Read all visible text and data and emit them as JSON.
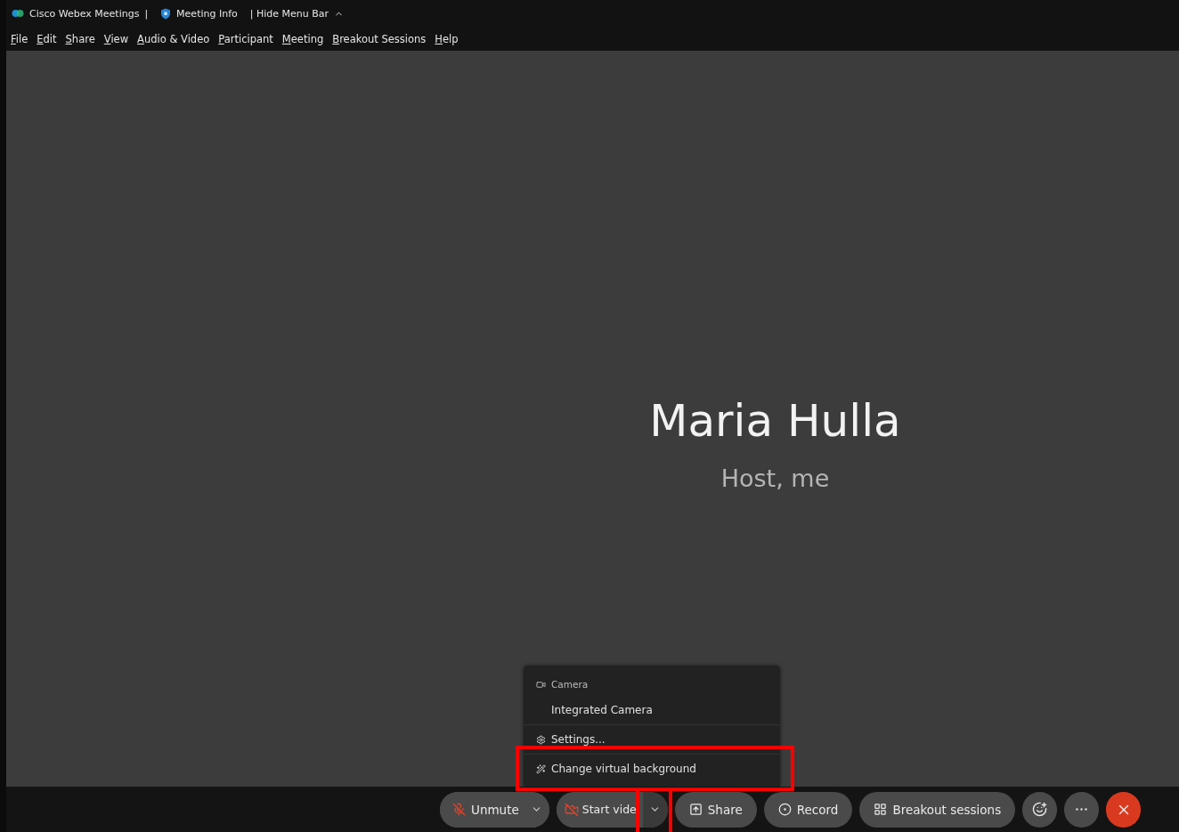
{
  "title_bar": {
    "app_name": "Cisco Webex Meetings",
    "separator": "|",
    "meeting_info": "Meeting Info",
    "hide_menu_bar": "| Hide Menu Bar"
  },
  "menu_bar": [
    "File",
    "Edit",
    "Share",
    "View",
    "Audio & Video",
    "Participant",
    "Meeting",
    "Breakout Sessions",
    "Help"
  ],
  "stage": {
    "name": "Maria Hulla",
    "role": "Host, me"
  },
  "video_menu": {
    "section": "Camera",
    "items": [
      {
        "kind": "option",
        "label": "Integrated Camera"
      },
      {
        "kind": "settings",
        "label": "Settings..."
      },
      {
        "kind": "background",
        "label": "Change virtual background"
      }
    ]
  },
  "controls": [
    {
      "kind": "audio",
      "label": "Unmute",
      "muted": true
    },
    {
      "kind": "video",
      "label": "Start vide",
      "muted": true
    },
    {
      "kind": "share",
      "label": "Share"
    },
    {
      "kind": "record",
      "label": "Record"
    },
    {
      "kind": "breakout",
      "label": "Breakout sessions"
    },
    {
      "kind": "reactions"
    },
    {
      "kind": "more"
    },
    {
      "kind": "end"
    }
  ]
}
